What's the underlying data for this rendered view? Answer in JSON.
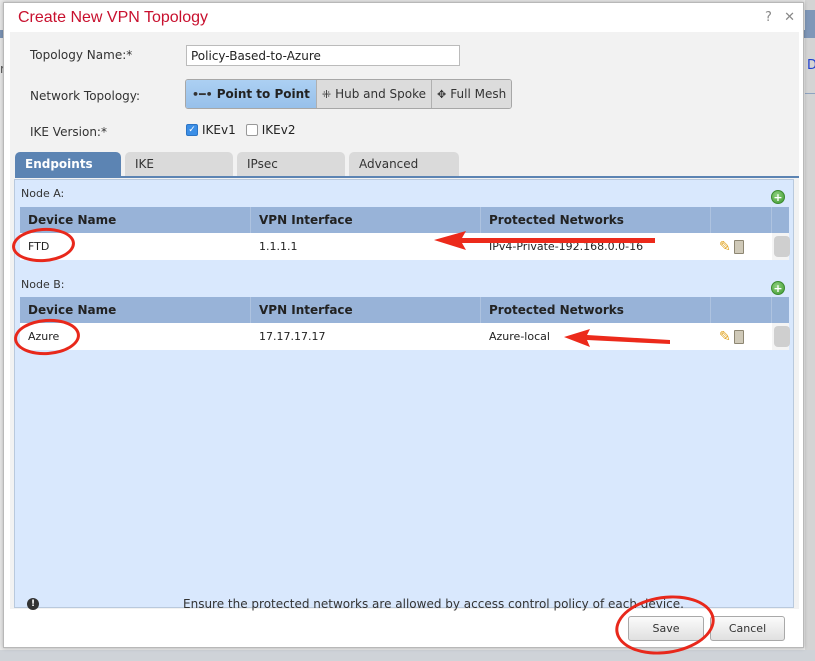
{
  "dialog": {
    "title": "Create New VPN Topology",
    "help_icon": "?",
    "close_icon": "✕"
  },
  "form": {
    "topology_name_label": "Topology Name:*",
    "topology_name_value": "Policy-Based-to-Azure",
    "network_topology_label": "Network Topology:",
    "topology_options": [
      {
        "label": "Point to Point",
        "icon": "point-to-point-icon",
        "glyph": "•━•",
        "selected": true
      },
      {
        "label": "Hub and Spoke",
        "icon": "hub-spoke-icon",
        "glyph": "⁜",
        "selected": false
      },
      {
        "label": "Full Mesh",
        "icon": "full-mesh-icon",
        "glyph": "✥",
        "selected": false
      }
    ],
    "ike_version_label": "IKE Version:*",
    "ike_options": [
      {
        "label": "IKEv1",
        "checked": true
      },
      {
        "label": "IKEv2",
        "checked": false
      }
    ]
  },
  "tabs": [
    {
      "label": "Endpoints",
      "active": true
    },
    {
      "label": "IKE",
      "active": false
    },
    {
      "label": "IPsec",
      "active": false
    },
    {
      "label": "Advanced",
      "active": false
    }
  ],
  "endpoints": {
    "columns": [
      "Device Name",
      "VPN Interface",
      "Protected Networks"
    ],
    "node_a": {
      "label": "Node A:",
      "rows": [
        {
          "device": "FTD",
          "interface": "1.1.1.1",
          "networks": "IPv4-Private-192.168.0.0-16"
        }
      ]
    },
    "node_b": {
      "label": "Node B:",
      "rows": [
        {
          "device": "Azure",
          "interface": "17.17.17.17",
          "networks": "Azure-local"
        }
      ]
    },
    "notice": "Ensure the protected networks are allowed by access control policy of each device.",
    "notice_icon": "!",
    "add_glyph": "+",
    "edit_glyph": "✎"
  },
  "footer": {
    "save_label": "Save",
    "cancel_label": "Cancel"
  },
  "background": {
    "right_char": "D"
  },
  "colors": {
    "title": "#c8102e",
    "tab_active": "#5c84b3",
    "panel": "#d9e8fd",
    "grid_header": "#98b3d8",
    "annotation": "#e8281b"
  }
}
